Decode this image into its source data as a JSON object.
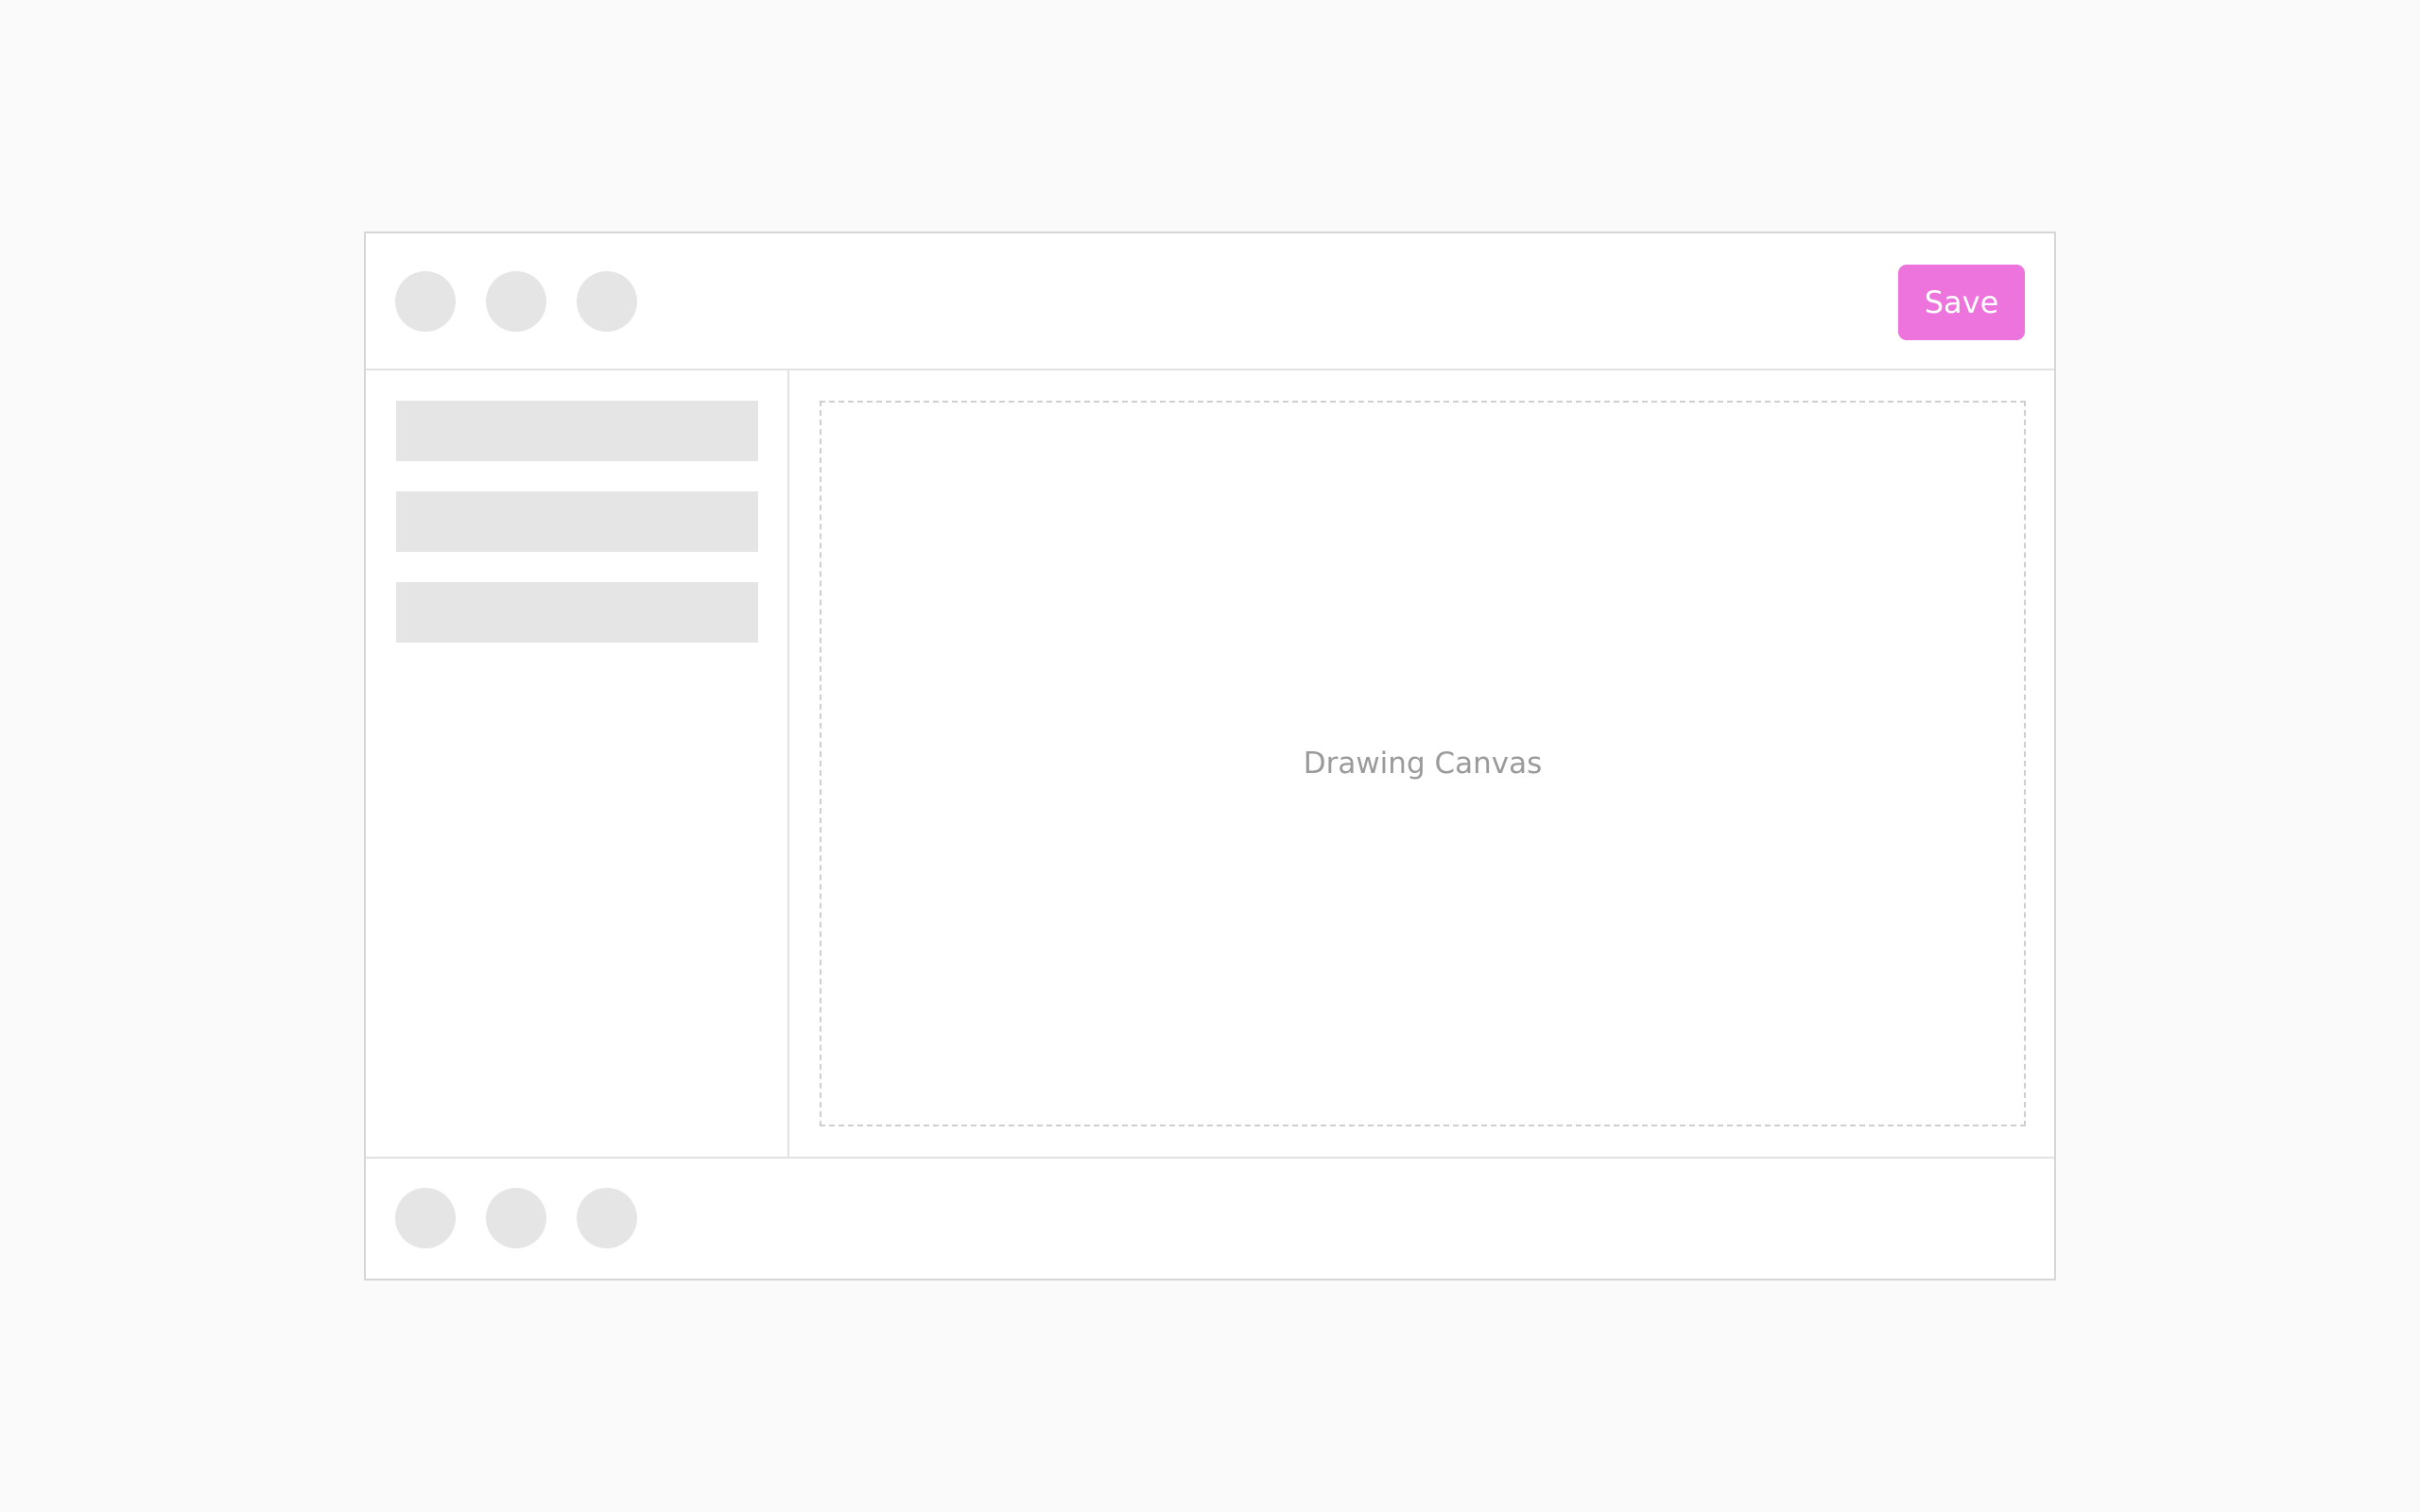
{
  "toolbar": {
    "tools": [
      {
        "icon": "tool-icon"
      },
      {
        "icon": "tool-icon"
      },
      {
        "icon": "tool-icon"
      }
    ],
    "save_label": "Save",
    "save_color": "#ec74dc"
  },
  "sidebar": {
    "items": [
      {
        "label": ""
      },
      {
        "label": ""
      },
      {
        "label": ""
      }
    ]
  },
  "canvas": {
    "label": "Drawing Canvas"
  },
  "bottom_bar": {
    "tools": [
      {
        "icon": "tool-icon"
      },
      {
        "icon": "tool-icon"
      },
      {
        "icon": "tool-icon"
      }
    ]
  }
}
